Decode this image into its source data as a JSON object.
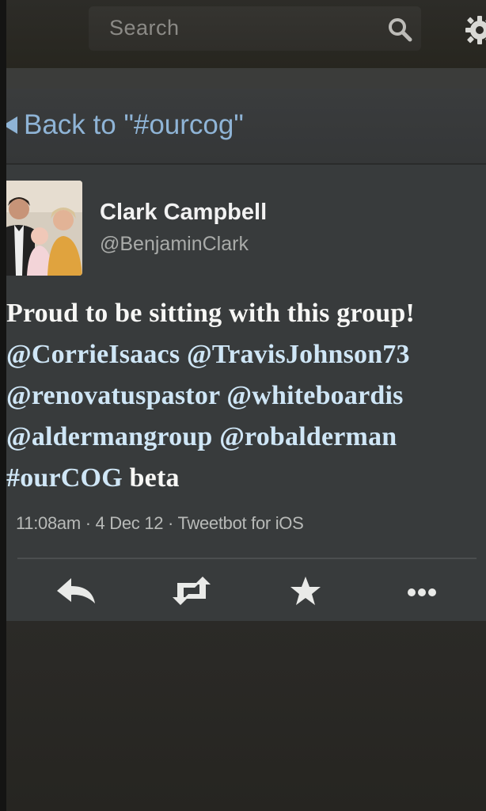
{
  "search": {
    "placeholder": "Search"
  },
  "nav": {
    "back_label": "Back to \"#ourcog\""
  },
  "tweet": {
    "display_name": "Clark Campbell",
    "handle": "@BenjaminClark",
    "lines": [
      [
        {
          "t": "plain",
          "v": "Proud to be sitting with this group!"
        }
      ],
      [
        {
          "t": "mention",
          "v": "@CorrieIsaacs"
        },
        {
          "t": "plain",
          "v": " "
        },
        {
          "t": "mention",
          "v": "@TravisJohnson73"
        }
      ],
      [
        {
          "t": "mention",
          "v": "@renovatuspastor"
        },
        {
          "t": "plain",
          "v": " "
        },
        {
          "t": "mention",
          "v": "@whiteboardis"
        }
      ],
      [
        {
          "t": "mention",
          "v": "@aldermangroup"
        },
        {
          "t": "plain",
          "v": " "
        },
        {
          "t": "mention",
          "v": "@robalderman"
        }
      ],
      [
        {
          "t": "hashtag",
          "v": "#ourCOG"
        },
        {
          "t": "plain",
          "v": " beta"
        }
      ]
    ],
    "meta": "11:08am · 4 Dec 12 · Tweetbot for iOS"
  },
  "actions": {
    "icons": [
      "reply-icon",
      "retweet-icon",
      "favorite-star-icon",
      "more-icon"
    ]
  },
  "colors": {
    "link": "#8fb4d6",
    "mention": "#cfe6f6",
    "text": "#f4f4f2"
  }
}
